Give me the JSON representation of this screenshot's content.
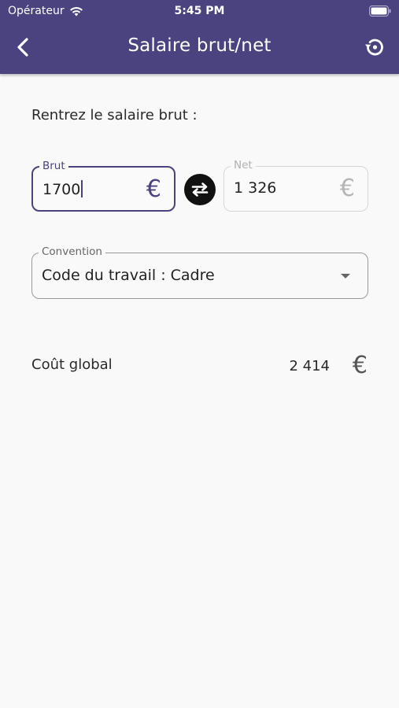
{
  "status_bar": {
    "carrier": "Opérateur",
    "time": "5:45 PM"
  },
  "navbar": {
    "title": "Salaire brut/net",
    "back_icon": "chevron-left-icon",
    "reset_icon": "history-reset-icon"
  },
  "form": {
    "prompt": "Rentrez le salaire brut :",
    "brut": {
      "label": "Brut",
      "value": "1700",
      "currency": "€"
    },
    "net": {
      "label": "Net",
      "value": "1 326",
      "currency": "€"
    },
    "swap_icon": "swap-arrows-icon",
    "convention": {
      "label": "Convention",
      "value": "Code du travail : Cadre"
    }
  },
  "summary": {
    "cost_label": "Coût global",
    "cost_value": "2 414",
    "currency": "€"
  },
  "colors": {
    "brand": "#4a4380",
    "background": "#f9f9f9"
  }
}
